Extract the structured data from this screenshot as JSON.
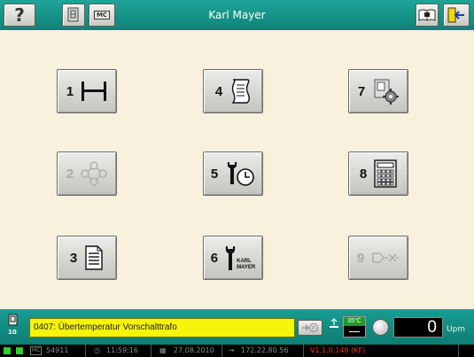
{
  "header": {
    "title": "Karl Mayer",
    "help_label": "?",
    "mc_label": "MC"
  },
  "tiles": [
    {
      "number": "1",
      "icon": "warp-beam-icon",
      "enabled": true
    },
    {
      "number": "2",
      "icon": "network-nodes-icon",
      "enabled": false
    },
    {
      "number": "3",
      "icon": "document-icon",
      "enabled": true
    },
    {
      "number": "4",
      "icon": "pattern-scroll-icon",
      "enabled": true
    },
    {
      "number": "5",
      "icon": "wrench-clock-icon",
      "enabled": true
    },
    {
      "number": "6",
      "icon": "wrench-karl-mayer-icon",
      "enabled": true,
      "icon_text": "KARL\nMAYER"
    },
    {
      "number": "7",
      "icon": "settings-gear-icon",
      "enabled": true
    },
    {
      "number": "8",
      "icon": "calculator-icon",
      "enabled": true
    },
    {
      "number": "9",
      "icon": "disconnected-plug-icon",
      "enabled": false
    }
  ],
  "status": {
    "page_number": "10",
    "message": "0407: Übertemperatur Vorschalttrafo",
    "temperature_label": "35°C",
    "speed_value": "0",
    "speed_unit": "Upm"
  },
  "info_bar": {
    "mc_id": "54911",
    "time": "11:59:16",
    "date": "27.08.2010",
    "ip": "172.22.80.56",
    "version": "V1.1.0.140 (KF)"
  },
  "colors": {
    "header_teal": "#129a8f",
    "background_cream": "#f7f1dd",
    "message_yellow": "#f5f40a",
    "version_red": "#ff2a2a"
  }
}
